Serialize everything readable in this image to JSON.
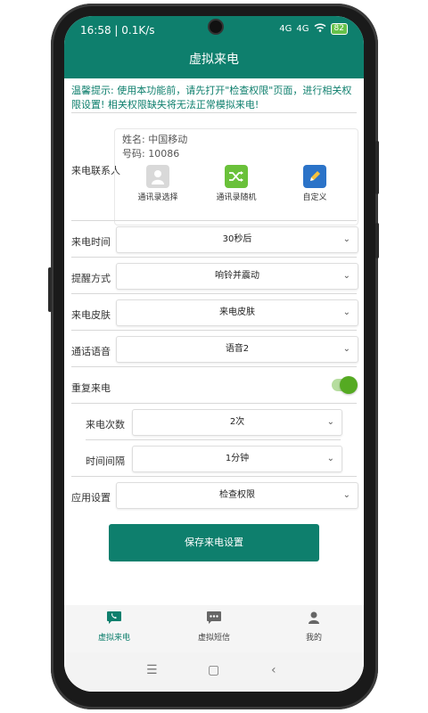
{
  "status": {
    "time": "16:58 | 0.1K/s",
    "signal1": "4G",
    "signal2": "4G",
    "battery": "82"
  },
  "header": {
    "title": "虚拟来电"
  },
  "notice": "温馨提示: 使用本功能前，请先打开\"检查权限\"页面，进行相关权限设置! 相关权限缺失将无法正常模拟来电!",
  "contact": {
    "label": "来电联系人",
    "name_line": "姓名: 中国移动",
    "number_line": "号码: 10086",
    "buttons": [
      "通讯录选择",
      "通讯录随机",
      "自定义"
    ]
  },
  "settings": {
    "call_time": {
      "label": "来电时间",
      "value": "30秒后"
    },
    "remind": {
      "label": "提醒方式",
      "value": "响铃并震动"
    },
    "skin": {
      "label": "来电皮肤",
      "value": "来电皮肤"
    },
    "voice": {
      "label": "通话语音",
      "value": "语音2"
    },
    "repeat": {
      "label": "重复来电",
      "enabled": true
    },
    "count": {
      "label": "来电次数",
      "value": "2次"
    },
    "interval": {
      "label": "时间间隔",
      "value": "1分钟"
    },
    "app": {
      "label": "应用设置",
      "value": "检查权限"
    }
  },
  "save_label": "保存来电设置",
  "tabs": [
    {
      "label": "虚拟来电",
      "icon": "phone-chat-icon",
      "active": true
    },
    {
      "label": "虚拟短信",
      "icon": "sms-icon",
      "active": false
    },
    {
      "label": "我的",
      "icon": "person-icon",
      "active": false
    }
  ],
  "colors": {
    "primary": "#0e7f6d",
    "toggle": "#55aa22"
  }
}
